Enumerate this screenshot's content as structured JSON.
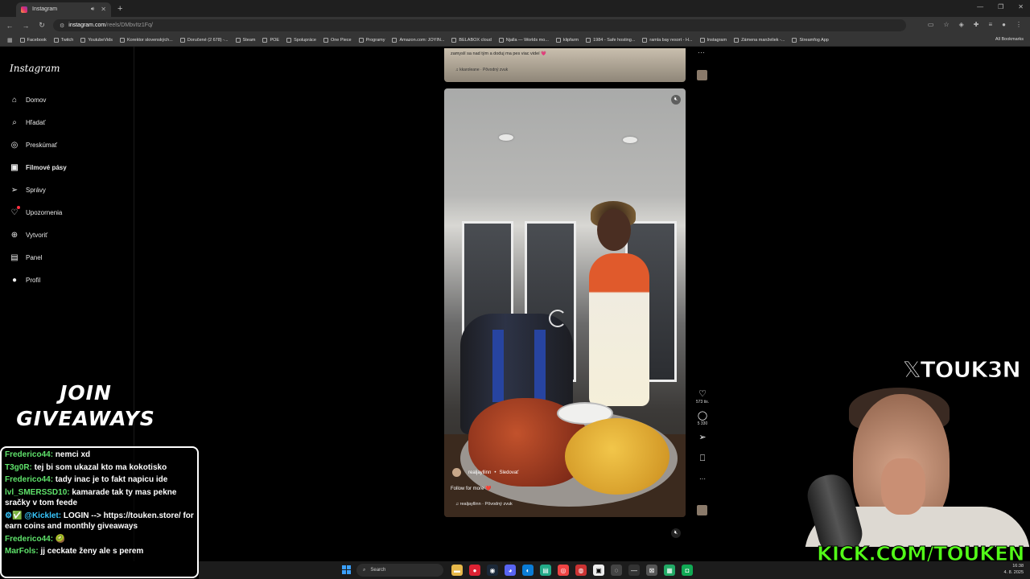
{
  "browser": {
    "tab_title": "Instagram",
    "tab_close": "✕",
    "new_tab": "+",
    "url_host": "instagram.com",
    "url_path": "/reels/DMbvItz1Fq/",
    "bookmarks": [
      "Facebook",
      "Twitch",
      "YoutubeVids",
      "Korektor slovenských...",
      "Doručené (2 678) -...",
      "Steam",
      "POE",
      "Spolupráce",
      "One Piece",
      "Programy",
      "Amazon.com: JOYIN...",
      "BELABOX cloud",
      "Njalla — Worlds mo...",
      "klipfarm",
      "1984 - Safe hosting...",
      "ramla bay resort - H...",
      "Instagram",
      "Zámena manželiek -...",
      "Streamfog App"
    ],
    "all_bookmarks": "All Bookmarks"
  },
  "sidebar": {
    "logo": "Instagram",
    "items": [
      {
        "label": "Domov",
        "icon": "home-icon",
        "glyph": "⌂"
      },
      {
        "label": "Hľadať",
        "icon": "search-icon",
        "glyph": "⌕"
      },
      {
        "label": "Preskúmať",
        "icon": "explore-icon",
        "glyph": "◎"
      },
      {
        "label": "Filmové pásy",
        "icon": "reels-icon",
        "glyph": "▣"
      },
      {
        "label": "Správy",
        "icon": "messages-icon",
        "glyph": "➢"
      },
      {
        "label": "Upozornenia",
        "icon": "heart-icon",
        "glyph": "♡"
      },
      {
        "label": "Vytvoriť",
        "icon": "create-icon",
        "glyph": "⊕"
      },
      {
        "label": "Panel",
        "icon": "dashboard-icon",
        "glyph": "▤"
      },
      {
        "label": "Profil",
        "icon": "profile-icon",
        "glyph": "●"
      }
    ],
    "active_index": 3
  },
  "reel_previous": {
    "caption": "zamyslí sa nad tým a doduj ma pes viac videí 💗",
    "audio": "♫ kkaroleane · Pôvodný zvuk"
  },
  "reel": {
    "username": "realjayllinn",
    "separator": "•",
    "follow_label": "Sledovať",
    "caption": "Follow for more ❤️",
    "audio": "♫ realjayllinn · Pôvodný zvuk",
    "likes": "573 tis.",
    "comments": "5 330",
    "more": "···"
  },
  "overlay": {
    "join_line1": "JOIN",
    "join_line2": "GIVEAWAYS",
    "twitter": "TOUK3N",
    "kick": "KICK.COM/TOUKEN"
  },
  "chat": [
    {
      "user": "Frederico44:",
      "text": " nemci xd"
    },
    {
      "user": "T3g0R:",
      "text": " tej bi som ukazal kto ma kokotisko"
    },
    {
      "user": "Frederico44:",
      "text": " tady inac je to fakt napicu ide"
    },
    {
      "user": "lvl_SMERSSD10:",
      "text": " kamarade tak ty mas pekne sračky v tom feede"
    },
    {
      "user": "⚙✅ @Kicklet:",
      "text": " LOGIN --> https://touken.store/ for earn coins and monthly giveaways",
      "kick": true
    },
    {
      "user": "Frederico44:",
      "text": " 🥝"
    },
    {
      "user": "MarFols:",
      "text": " jj ceckate ženy ale s perem"
    }
  ],
  "taskbar": {
    "search": "Search",
    "time": "16:38",
    "date": "4. 8. 2025"
  }
}
